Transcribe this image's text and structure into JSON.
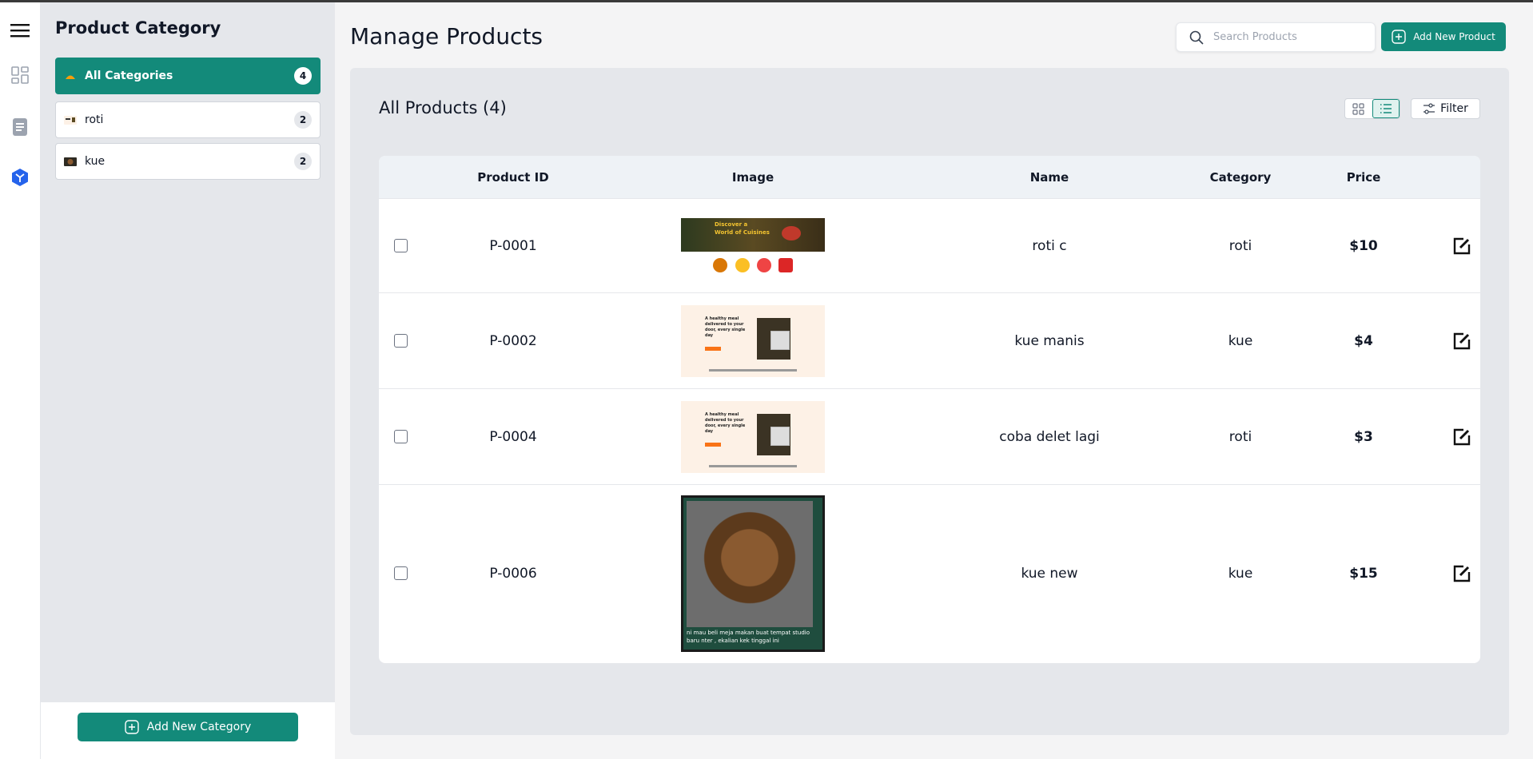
{
  "sidebar_panel": {
    "title": "Product Category",
    "categories": [
      {
        "label": "All Categories",
        "count": "4"
      },
      {
        "label": "roti",
        "count": "2"
      },
      {
        "label": "kue",
        "count": "2"
      }
    ],
    "add_button": "Add New Category"
  },
  "header": {
    "title": "Manage Products",
    "search_placeholder": "Search Products",
    "add_button": "Add New Product"
  },
  "products_panel": {
    "title": "All Products (4)",
    "filter_label": "Filter"
  },
  "table": {
    "columns": [
      "Product ID",
      "Image",
      "Name",
      "Category",
      "Price"
    ],
    "rows": [
      {
        "id": "P-0001",
        "name": "roti c",
        "category": "roti",
        "price": "$10"
      },
      {
        "id": "P-0002",
        "name": "kue manis",
        "category": "kue",
        "price": "$4"
      },
      {
        "id": "P-0004",
        "name": "coba delet lagi",
        "category": "roti",
        "price": "$3"
      },
      {
        "id": "P-0006",
        "name": "kue new",
        "category": "kue",
        "price": "$15"
      }
    ],
    "thumb_texts": {
      "p1_hero_line1": "Discover a",
      "p1_hero_line2": "World of Cuisines",
      "p2_headline": "A healthy meal delivered to your door, every single day",
      "p6_caption": "ni mau beli meja makan buat tempat studio baru nter , ekalian kek tinggal ini"
    }
  },
  "colors": {
    "accent": "#138a7a",
    "active_rail_icon": "#2563eb"
  }
}
